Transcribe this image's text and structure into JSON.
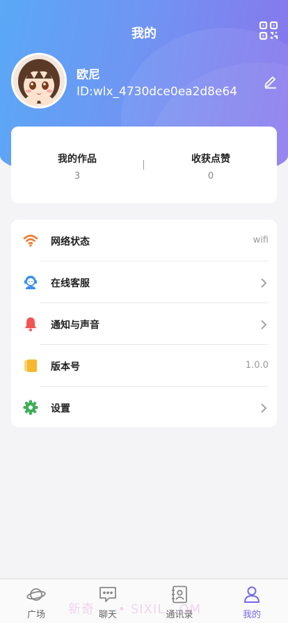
{
  "header": {
    "title": "我的",
    "username": "欧尼",
    "user_id": "ID:wlx_4730dce0ea2d8e64"
  },
  "stats": [
    {
      "label": "我的作品",
      "value": "3"
    },
    {
      "label": "收获点赞",
      "value": "0"
    }
  ],
  "menu": [
    {
      "label": "网络状态",
      "right": "wifi",
      "icon": "wifi-icon"
    },
    {
      "label": "在线客服",
      "right": "",
      "icon": "customer-service-icon"
    },
    {
      "label": "通知与声音",
      "right": "",
      "icon": "bell-icon"
    },
    {
      "label": "版本号",
      "right": "1.0.0",
      "icon": "version-icon"
    },
    {
      "label": "设置",
      "right": "",
      "icon": "gear-icon"
    }
  ],
  "tabs": [
    {
      "label": "广场",
      "icon": "planet-icon"
    },
    {
      "label": "聊天",
      "icon": "chat-icon"
    },
    {
      "label": "通讯录",
      "icon": "contacts-icon"
    },
    {
      "label": "我的",
      "icon": "person-icon",
      "active": true
    }
  ],
  "watermark": "新奇 ... • SIXIL...OM",
  "colors": {
    "accent": "#7468e8",
    "header_start": "#5aa8f6",
    "header_end": "#8a74ec",
    "wifi": "#f07a2b",
    "bell": "#f25454",
    "version": "#f5b82e",
    "gear": "#3fae5a",
    "service": "#3a8ef0"
  }
}
